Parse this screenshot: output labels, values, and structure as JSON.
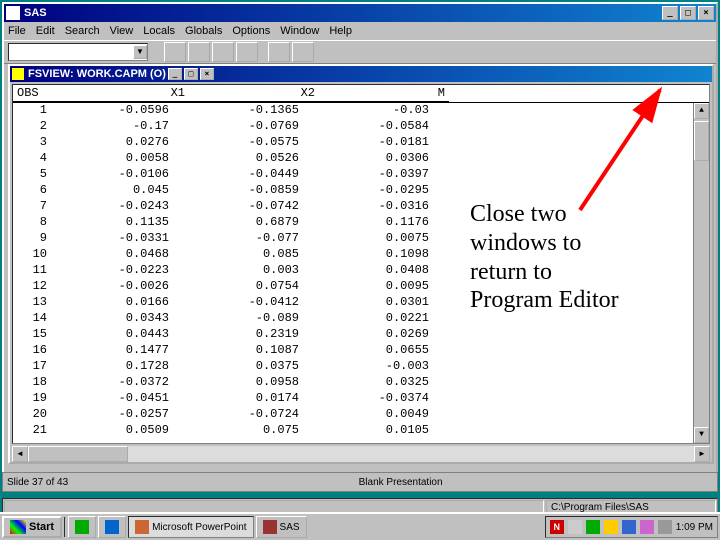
{
  "outer": {
    "title": "SAS",
    "menu": [
      "File",
      "Edit",
      "Search",
      "View",
      "Locals",
      "Globals",
      "Options",
      "Window",
      "Help"
    ]
  },
  "inner": {
    "title": "FSVIEW: WORK.CAPM (O)",
    "columns": {
      "obs": "OBS",
      "x1": "X1",
      "x2": "X2",
      "m": "M"
    },
    "rows": [
      {
        "obs": "1",
        "x1": "-0.0596",
        "x2": "-0.1365",
        "m": "-0.03"
      },
      {
        "obs": "2",
        "x1": "-0.17",
        "x2": "-0.0769",
        "m": "-0.0584"
      },
      {
        "obs": "3",
        "x1": "0.0276",
        "x2": "-0.0575",
        "m": "-0.0181"
      },
      {
        "obs": "4",
        "x1": "0.0058",
        "x2": "0.0526",
        "m": "0.0306"
      },
      {
        "obs": "5",
        "x1": "-0.0106",
        "x2": "-0.0449",
        "m": "-0.0397"
      },
      {
        "obs": "6",
        "x1": "0.045",
        "x2": "-0.0859",
        "m": "-0.0295"
      },
      {
        "obs": "7",
        "x1": "-0.0243",
        "x2": "-0.0742",
        "m": "-0.0316"
      },
      {
        "obs": "8",
        "x1": "0.1135",
        "x2": "0.6879",
        "m": "0.1176"
      },
      {
        "obs": "9",
        "x1": "-0.0331",
        "x2": "-0.077",
        "m": "0.0075"
      },
      {
        "obs": "10",
        "x1": "0.0468",
        "x2": "0.085",
        "m": "0.1098"
      },
      {
        "obs": "11",
        "x1": "-0.0223",
        "x2": "0.003",
        "m": "0.0408"
      },
      {
        "obs": "12",
        "x1": "-0.0026",
        "x2": "0.0754",
        "m": "0.0095"
      },
      {
        "obs": "13",
        "x1": "0.0166",
        "x2": "-0.0412",
        "m": "0.0301"
      },
      {
        "obs": "14",
        "x1": "0.0343",
        "x2": "-0.089",
        "m": "0.0221"
      },
      {
        "obs": "15",
        "x1": "0.0443",
        "x2": "0.2319",
        "m": "0.0269"
      },
      {
        "obs": "16",
        "x1": "0.1477",
        "x2": "0.1087",
        "m": "0.0655"
      },
      {
        "obs": "17",
        "x1": "0.1728",
        "x2": "0.0375",
        "m": "-0.003"
      },
      {
        "obs": "18",
        "x1": "-0.0372",
        "x2": "0.0958",
        "m": "0.0325"
      },
      {
        "obs": "19",
        "x1": "-0.0451",
        "x2": "0.0174",
        "m": "-0.0374"
      },
      {
        "obs": "20",
        "x1": "-0.0257",
        "x2": "-0.0724",
        "m": "0.0049"
      },
      {
        "obs": "21",
        "x1": "0.0509",
        "x2": "0.075",
        "m": "0.0105"
      }
    ]
  },
  "note": "Close two windows to return to Program Editor",
  "bottom_status": {
    "slide": "Slide 37 of 43",
    "title": "Blank Presentation"
  },
  "status_path": "C:\\Program Files\\SAS",
  "taskbar": {
    "start": "Start",
    "items": [
      {
        "label": "Microsoft PowerPoint",
        "active": true
      },
      {
        "label": "SAS",
        "active": false
      }
    ],
    "clock": "1:09 PM"
  },
  "tray_icons": [
    "N",
    "speaker",
    "net",
    "a",
    "b",
    "c",
    "user"
  ]
}
